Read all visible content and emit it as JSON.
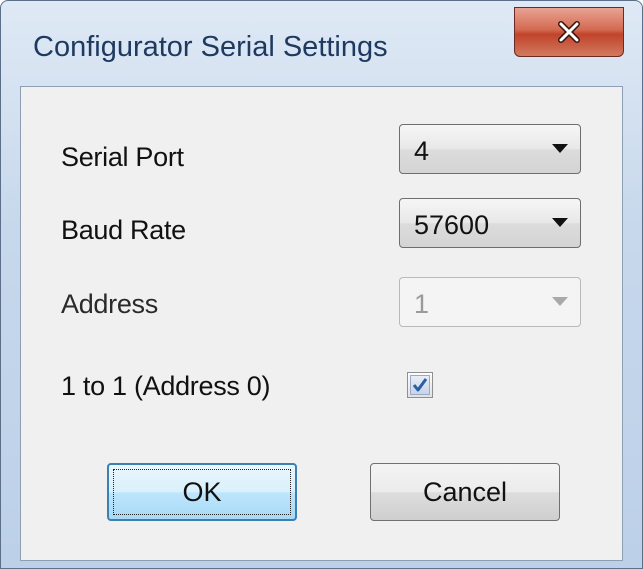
{
  "window": {
    "title": "Configurator Serial Settings",
    "close_icon": "close-icon"
  },
  "form": {
    "serial_port": {
      "label": "Serial Port",
      "value": "4"
    },
    "baud_rate": {
      "label": "Baud Rate",
      "value": "57600"
    },
    "address": {
      "label": "Address",
      "value": "1",
      "disabled": true
    },
    "one_to_one": {
      "label": "1 to 1 (Address 0)",
      "checked": true
    }
  },
  "buttons": {
    "ok": "OK",
    "cancel": "Cancel"
  },
  "colors": {
    "close_button": "#c0442b",
    "ok_focus_border": "#3c7fb1",
    "check_mark": "#2a5fa8"
  }
}
